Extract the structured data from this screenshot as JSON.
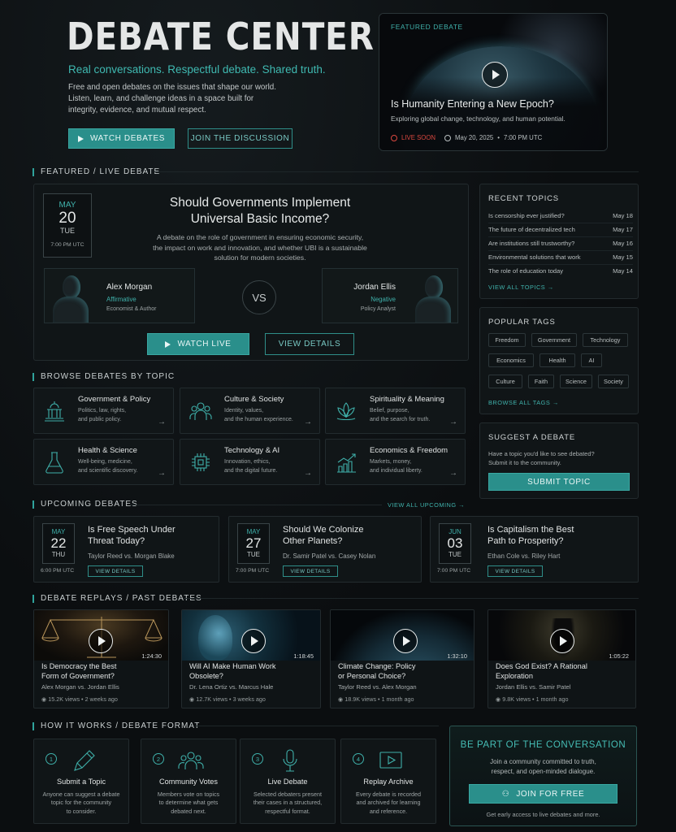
{
  "hero": {
    "title": "DEBATE CENTER",
    "subtitle": "Real conversations. Respectful debate. Shared truth.",
    "desc_line1": "Free and open debates on the issues that shape our world.",
    "desc_line2": "Listen, learn, and challenge ideas in a space built for",
    "desc_line3": "integrity, evidence, and mutual respect.",
    "watch_label": "WATCH DEBATES",
    "join_label": "JOIN THE DISCUSSION"
  },
  "featured": {
    "tag": "FEATURED DEBATE",
    "title": "Is Humanity Entering a New Epoch?",
    "desc": "Exploring global change, technology, and human potential.",
    "status": "LIVE SOON",
    "date": "May 20, 2025",
    "time": "7:00 PM UTC"
  },
  "section_featured": "FEATURED / LIVE DEBATE",
  "main_debate": {
    "month": "MAY",
    "day": "20",
    "weekday": "TUE",
    "time": "7:00 PM UTC",
    "title_line1": "Should Governments Implement",
    "title_line2": "Universal Basic Income?",
    "desc_line1": "A debate on the role of government in ensuring economic security,",
    "desc_line2": "the impact on work and innovation, and whether UBI is a sustainable",
    "desc_line3": "solution for modern societies.",
    "vs": "VS",
    "left": {
      "name": "Alex Morgan",
      "side": "Affirmative",
      "role": "Economist & Author"
    },
    "right": {
      "name": "Jordan Ellis",
      "side": "Negative",
      "role": "Policy Analyst"
    },
    "watch_live": "WATCH LIVE",
    "view_details": "VIEW DETAILS"
  },
  "recent": {
    "heading": "RECENT TOPICS",
    "items": [
      {
        "title": "Is censorship ever justified?",
        "date": "May 18"
      },
      {
        "title": "The future of decentralized tech",
        "date": "May 17"
      },
      {
        "title": "Are institutions still trustworthy?",
        "date": "May 16"
      },
      {
        "title": "Environmental solutions that work",
        "date": "May 15"
      },
      {
        "title": "The role of education today",
        "date": "May 14"
      }
    ],
    "view_all": "VIEW ALL TOPICS →"
  },
  "tags": {
    "heading": "POPULAR TAGS",
    "items": [
      "Freedom",
      "Government",
      "Technology",
      "Economics",
      "Health",
      "AI",
      "Culture",
      "Faith",
      "Science",
      "Society"
    ],
    "browse_all": "BROWSE ALL TAGS →"
  },
  "suggest": {
    "heading": "SUGGEST A DEBATE",
    "line1": "Have a topic you'd like to see debated?",
    "line2": "Submit it to the community.",
    "button": "SUBMIT TOPIC"
  },
  "section_topics": "BROWSE DEBATES BY TOPIC",
  "topics": [
    {
      "title": "Government & Policy",
      "d1": "Politics, law, rights,",
      "d2": "and public policy.",
      "icon": "capitol-icon"
    },
    {
      "title": "Culture & Society",
      "d1": "Identity, values,",
      "d2": "and the human experience.",
      "icon": "people-icon"
    },
    {
      "title": "Spirituality & Meaning",
      "d1": "Belief, purpose,",
      "d2": "and the search for truth.",
      "icon": "lotus-icon"
    },
    {
      "title": "Health & Science",
      "d1": "Well-being, medicine,",
      "d2": "and scientific discovery.",
      "icon": "flask-icon"
    },
    {
      "title": "Technology & AI",
      "d1": "Innovation, ethics,",
      "d2": "and the digital future.",
      "icon": "chip-icon"
    },
    {
      "title": "Economics & Freedom",
      "d1": "Markets, money,",
      "d2": "and individual liberty.",
      "icon": "chart-icon"
    }
  ],
  "arrow": "→",
  "section_upcoming": "UPCOMING DEBATES",
  "view_all_upcoming": "VIEW ALL UPCOMING →",
  "upcoming": [
    {
      "month": "MAY",
      "day": "22",
      "weekday": "THU",
      "time": "6:00 PM UTC",
      "t1": "Is Free Speech Under",
      "t2": "Threat Today?",
      "who": "Taylor Reed vs. Morgan Blake",
      "btn": "VIEW DETAILS"
    },
    {
      "month": "MAY",
      "day": "27",
      "weekday": "TUE",
      "time": "7:00 PM UTC",
      "t1": "Should We Colonize",
      "t2": "Other Planets?",
      "who": "Dr. Samir Patel vs. Casey Nolan",
      "btn": "VIEW DETAILS"
    },
    {
      "month": "JUN",
      "day": "03",
      "weekday": "TUE",
      "time": "7:00 PM UTC",
      "t1": "Is Capitalism the Best",
      "t2": "Path to Prosperity?",
      "who": "Ethan Cole vs. Riley Hart",
      "btn": "VIEW DETAILS"
    }
  ],
  "section_replays": "DEBATE REPLAYS / PAST DEBATES",
  "replays": [
    {
      "duration": "1:24:30",
      "t1": "Is Democracy the Best",
      "t2": "Form of Government?",
      "who": "Alex Morgan vs. Jordan Ellis",
      "views": "15.2K views",
      "age": "2 weeks ago"
    },
    {
      "duration": "1:18:45",
      "t1": "Will AI Make Human Work",
      "t2": "Obsolete?",
      "who": "Dr. Lena Ortiz vs. Marcus Hale",
      "views": "12.7K views",
      "age": "3 weeks ago"
    },
    {
      "duration": "1:32:10",
      "t1": "Climate Change: Policy",
      "t2": "or Personal Choice?",
      "who": "Taylor Reed vs. Alex Morgan",
      "views": "18.9K views",
      "age": "1 month ago"
    },
    {
      "duration": "1:05:22",
      "t1": "Does God Exist? A Rational",
      "t2": "Exploration",
      "who": "Jordan Ellis vs. Samir Patel",
      "views": "9.8K views",
      "age": "1 month ago"
    }
  ],
  "section_how": "HOW IT WORKS / DEBATE FORMAT",
  "how": [
    {
      "num": "1",
      "title": "Submit a Topic",
      "d1": "Anyone can suggest a debate",
      "d2": "topic for the community",
      "d3": "to consider."
    },
    {
      "num": "2",
      "title": "Community Votes",
      "d1": "Members vote on topics",
      "d2": "to determine what gets",
      "d3": "debated next."
    },
    {
      "num": "3",
      "title": "Live Debate",
      "d1": "Selected debaters present",
      "d2": "their cases in a structured,",
      "d3": "respectful format."
    },
    {
      "num": "4",
      "title": "Replay Archive",
      "d1": "Every debate is recorded",
      "d2": "and archived for learning",
      "d3": "and reference."
    }
  ],
  "join": {
    "heading": "BE PART OF THE CONVERSATION",
    "line1": "Join a community committed to truth,",
    "line2": "respect, and open-minded dialogue.",
    "button": "JOIN FOR FREE",
    "footnote": "Get early access to live debates and more."
  },
  "colors": {
    "accent": "#2a8f8b",
    "accent_text": "#3fb0aa",
    "live": "#d9473f",
    "background": "#0b0e10"
  }
}
